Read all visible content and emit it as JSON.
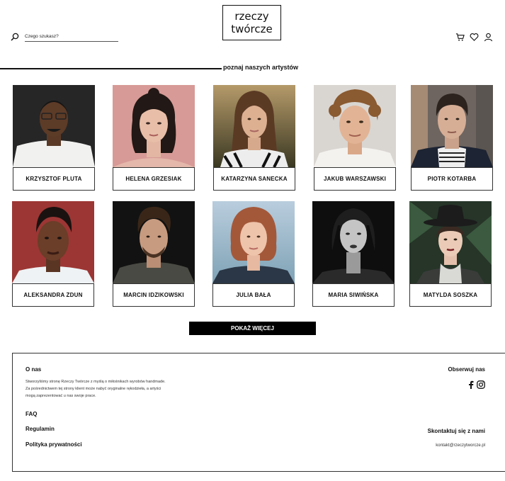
{
  "header": {
    "logo_line1": "rzeczy",
    "logo_line2": "twórcze",
    "search_placeholder": "Czego szukasz?",
    "icons": [
      "search-icon",
      "cart-icon",
      "heart-icon",
      "user-icon"
    ]
  },
  "section_title": "poznaj naszych artystów",
  "artists": [
    {
      "name": "KRZYSZTOF PLUTA"
    },
    {
      "name": "HELENA GRZESIAK"
    },
    {
      "name": "KATARZYNA SANECKA"
    },
    {
      "name": "JAKUB WARSZAWSKI"
    },
    {
      "name": "PIOTR KOTARBA"
    },
    {
      "name": "ALEKSANDRA ZDUN"
    },
    {
      "name": "MARCIN IDZIKOWSKI"
    },
    {
      "name": "JULIA BAŁA"
    },
    {
      "name": "MARIA SIWIŃSKA"
    },
    {
      "name": "MATYLDA SOSZKA"
    }
  ],
  "more_button": "POKAŻ WIĘCEJ",
  "footer": {
    "about_heading": "O nas",
    "about_line1": "Stworzyliśmy stronę Rzeczy Twórcze z myślą o miłośnikach wyrobów handmade.",
    "about_line2": "Za pośrednictwem tej strony klient może nabyć oryginalne rękodzieła, a artyści",
    "about_line3": "mogą zaprezentować u nas swoje prace.",
    "links": [
      "FAQ",
      "Regulamin",
      "Polityka prywatności"
    ],
    "follow_heading": "Obserwuj nas",
    "social_icons": [
      "facebook-icon",
      "instagram-icon"
    ],
    "contact_heading": "Skontaktuj się z nami",
    "contact_email": "kontakt@rzeczytworcze.pl"
  }
}
